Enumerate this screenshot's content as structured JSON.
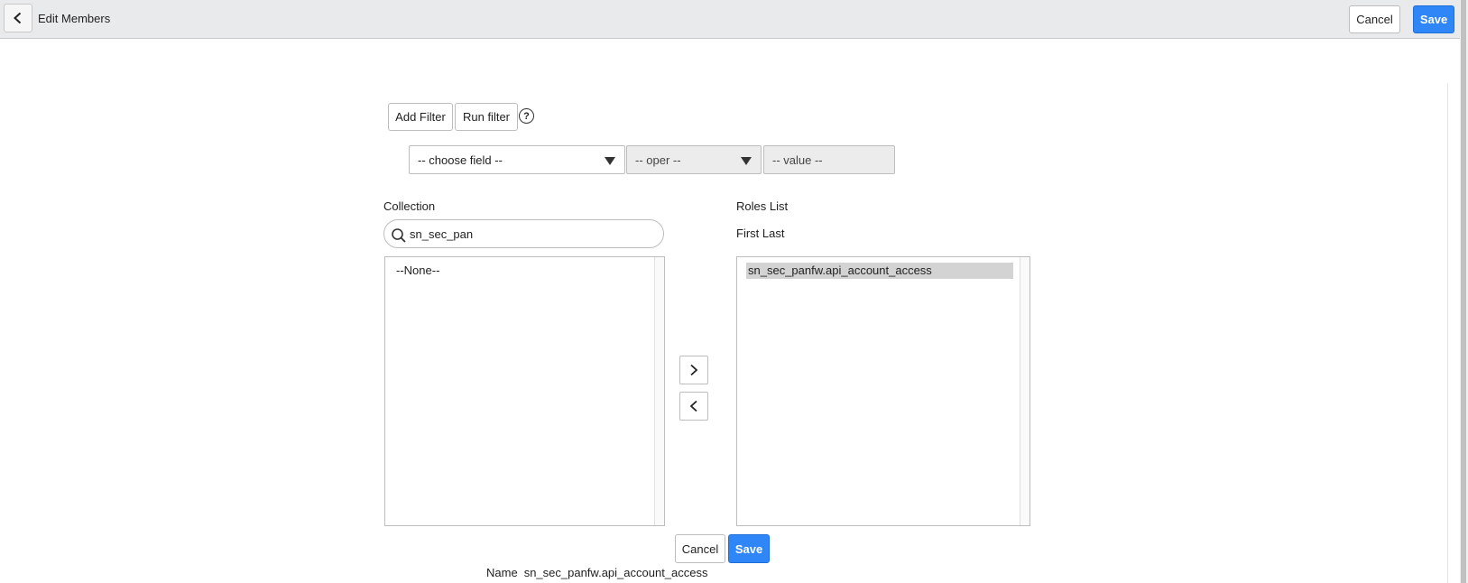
{
  "header": {
    "title": "Edit Members",
    "cancel_label": "Cancel",
    "save_label": "Save"
  },
  "filter": {
    "add_filter_label": "Add Filter",
    "run_filter_label": "Run filter",
    "help_glyph": "?",
    "field_select": "-- choose field --",
    "oper_select": "-- oper --",
    "value_input": "-- value --"
  },
  "collection": {
    "label": "Collection",
    "search_value": "sn_sec_pan",
    "items": [
      "--None--"
    ]
  },
  "roles": {
    "label": "Roles List",
    "sort_label": "First Last",
    "items": [
      "sn_sec_panfw.api_account_access"
    ]
  },
  "footer": {
    "cancel_label": "Cancel",
    "save_label": "Save",
    "name_key": "Name",
    "name_value": "sn_sec_panfw.api_account_access"
  },
  "colors": {
    "primary": "#2f86f6",
    "header_bg": "#e9eaec",
    "selected_item": "#d3d3d3"
  },
  "icons": {
    "back": "chevron-left-icon",
    "help": "help-circle-icon",
    "search": "search-icon",
    "move_right": "chevron-right-icon",
    "move_left": "chevron-left-icon",
    "dropdown": "caret-down-icon"
  }
}
